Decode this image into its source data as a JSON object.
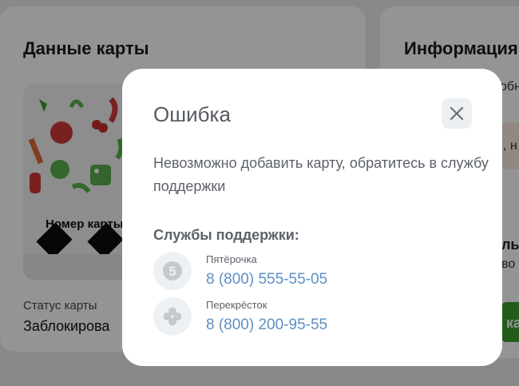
{
  "background": {
    "card_section_title": "Данные карты",
    "info_section_title": "Информация",
    "card_number_label": "Номер карты",
    "status_label": "Статус карты",
    "status_value": "Заблокирова"
  },
  "modal": {
    "title": "Ошибка",
    "message": "Невозможно добавить карту, обратитесь в службу поддержки",
    "support_heading": "Службы поддержки:",
    "support": [
      {
        "name": "Пятёрочка",
        "phone": "8 (800) 555-55-05",
        "icon": "pyaterochka-logo-icon"
      },
      {
        "name": "Перекрёсток",
        "phone": "8 (800) 200-95-55",
        "icon": "perekrestok-logo-icon"
      }
    ]
  },
  "colors": {
    "title": "#555a61",
    "link": "#5d8fc4",
    "icon_bg": "#eef1f4"
  }
}
